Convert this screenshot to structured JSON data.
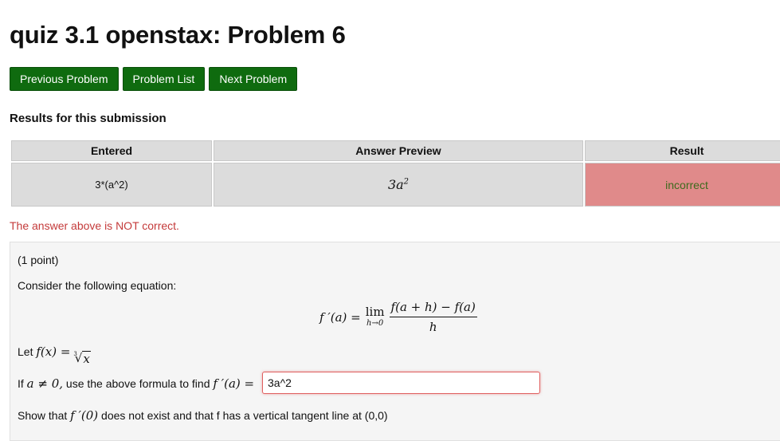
{
  "page": {
    "title": "quiz 3.1 openstax: Problem 6"
  },
  "nav": {
    "previous": "Previous Problem",
    "list": "Problem List",
    "next": "Next Problem"
  },
  "results": {
    "heading": "Results for this submission",
    "columns": [
      "Entered",
      "Answer Preview",
      "Result"
    ],
    "row": {
      "entered": "3*(a^2)",
      "preview_base": "3a",
      "preview_exp": "2",
      "result": "incorrect"
    },
    "message": "The answer above is NOT correct."
  },
  "problem": {
    "points": "(1 point)",
    "intro": "Consider the following equation:",
    "formula": {
      "lhs": "f ′(a) =",
      "lim": "lim",
      "lim_sub": "h→0",
      "numerator": "f(a + h) − f(a)",
      "denominator": "h"
    },
    "let_text": "Let",
    "let_math": "f(x) =",
    "let_radicand": "x",
    "let_index": "3",
    "ask_text_1": "If",
    "ask_math_1": "a ≠ 0,",
    "ask_text_2": "use the above formula to find",
    "ask_math_2": "f ′(a) =",
    "answer_value": "3a^2",
    "show_text_1": "Show that",
    "show_math": "f ′(0)",
    "show_text_2": "does not exist and that f has a vertical tangent line at (0,0)"
  },
  "colors": {
    "button": "#0f6b0f",
    "incorrect_bg": "#e08a8a",
    "incorrect_text": "#3d6b1d",
    "error_text": "#c43a3a"
  }
}
